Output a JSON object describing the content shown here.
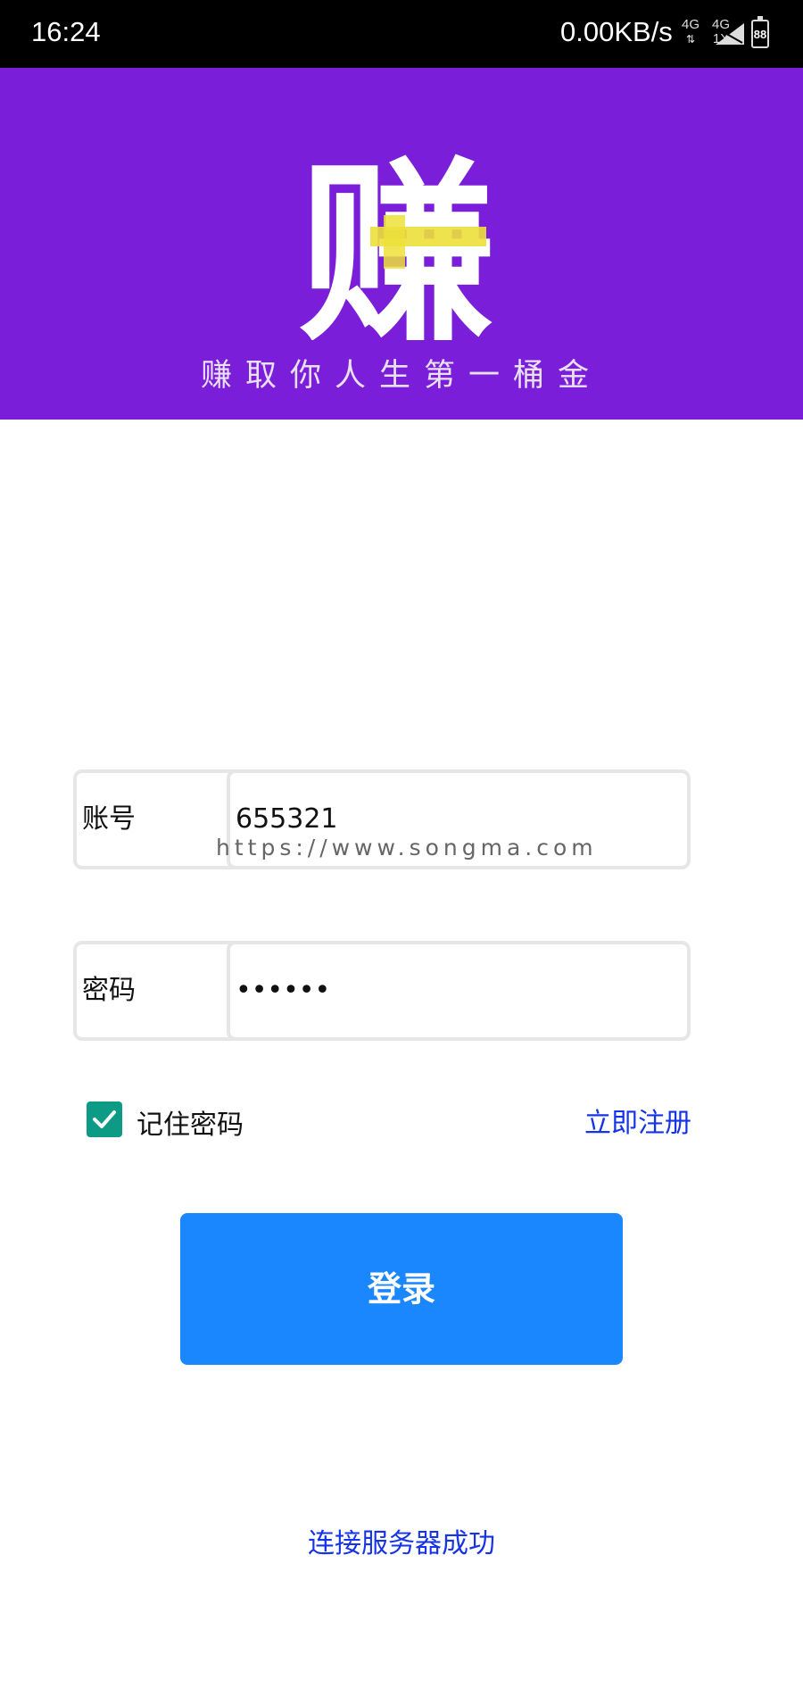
{
  "status_bar": {
    "time": "16:24",
    "speed": "0.00KB/s",
    "network1": "4G",
    "network2": "4G",
    "network2_sub": "1X",
    "battery": "88"
  },
  "banner": {
    "logo_text": "赚",
    "slogan": "赚取你人生第一桶金",
    "background": "#7b1ed9",
    "logo_accent": "#ece03a"
  },
  "form": {
    "account": {
      "label": "账号",
      "value": "655321"
    },
    "password": {
      "label": "密码",
      "value": "••••••"
    },
    "watermark": "https://www.songma.com",
    "remember_label": "记住密码",
    "remember_checked": true,
    "register_label": "立即注册",
    "login_label": "登录"
  },
  "status_message": "连接服务器成功",
  "colors": {
    "primary_button": "#1a87ff",
    "link": "#1633e6",
    "checkbox": "#0e9b86"
  }
}
